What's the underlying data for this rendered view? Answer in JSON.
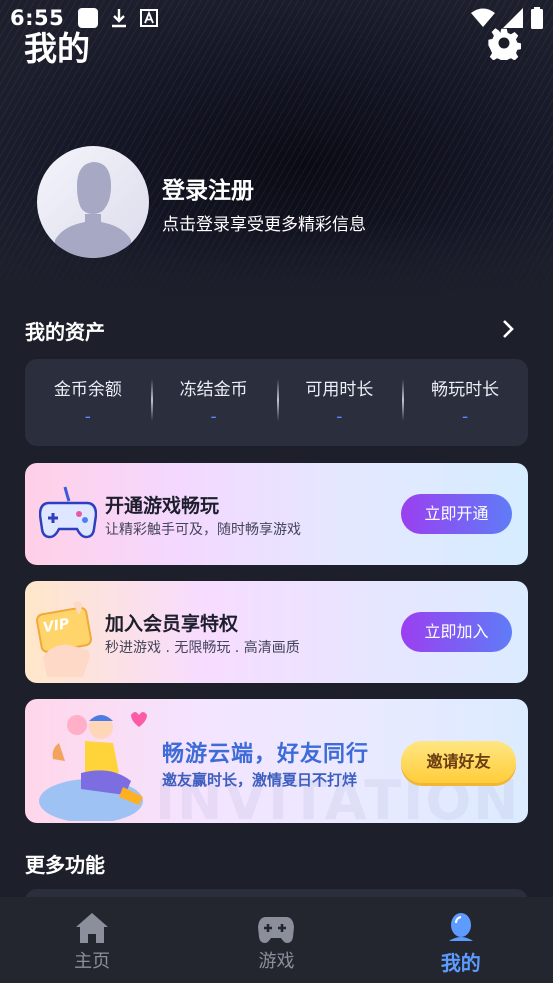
{
  "status_bar": {
    "time": "6:55",
    "icons": [
      "notification-icon",
      "download-icon",
      "font-icon",
      "wifi-icon",
      "signal-icon",
      "battery-icon"
    ]
  },
  "header": {
    "title": "我的"
  },
  "profile": {
    "login_title": "登录注册",
    "login_subtitle": "点击登录享受更多精彩信息"
  },
  "assets": {
    "section_title": "我的资产",
    "items": [
      {
        "label": "金币余额",
        "value": "-"
      },
      {
        "label": "冻结金币",
        "value": "-"
      },
      {
        "label": "可用时长",
        "value": "-"
      },
      {
        "label": "畅玩时长",
        "value": "-"
      }
    ]
  },
  "promos": [
    {
      "title": "开通游戏畅玩",
      "subtitle": "让精彩触手可及，随时畅享游戏",
      "button": "立即开通"
    },
    {
      "title": "加入会员享特权",
      "subtitle": "秒进游戏 . 无限畅玩 . 高清画质",
      "button": "立即加入",
      "badge": "VIP"
    },
    {
      "title": "畅游云端，好友同行",
      "subtitle": "邀友赢时长，激情夏日不打烊",
      "button": "邀请好友",
      "watermark": "INVITATION"
    }
  ],
  "more": {
    "section_title": "更多功能"
  },
  "tabbar": {
    "tabs": [
      {
        "label": "主页",
        "active": false
      },
      {
        "label": "游戏",
        "active": false
      },
      {
        "label": "我的",
        "active": true
      }
    ]
  },
  "colors": {
    "background": "#1d1f2b",
    "accent_blue": "#5e9bff",
    "button_purple": "#9b3ff0",
    "button_yellow": "#ffcd3a"
  }
}
